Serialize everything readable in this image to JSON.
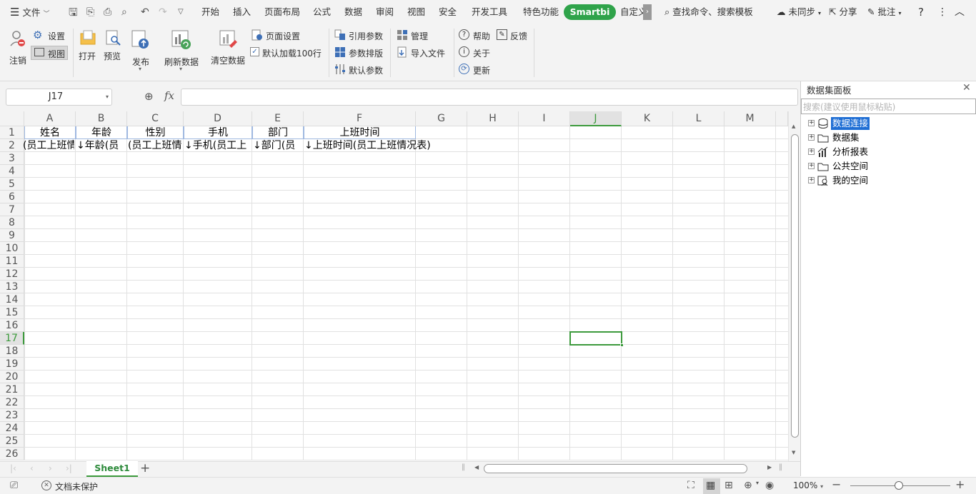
{
  "menu": {
    "file": "文件",
    "tabs": [
      "开始",
      "插入",
      "页面布局",
      "公式",
      "数据",
      "审阅",
      "视图",
      "安全",
      "开发工具",
      "特色功能"
    ],
    "smartbi": "Smartbi",
    "custom": "自定义",
    "search": "查找命令、搜索模板",
    "sync": "未同步",
    "share": "分享",
    "comment": "批注"
  },
  "ribbon": {
    "logout": "注销",
    "settings": "设置",
    "view": "视图",
    "open": "打开",
    "preview": "预览",
    "publish": "发布",
    "refresh": "刷新数据",
    "clear": "清空数据",
    "page_setup": "页面设置",
    "load100": "默认加载100行",
    "ref_param": "引用参数",
    "param_layout": "参数排版",
    "default_param": "默认参数",
    "manage": "管理",
    "import": "导入文件",
    "help": "帮助",
    "feedback": "反馈",
    "about": "关于",
    "update": "更新"
  },
  "formula_bar": {
    "cell_ref": "J17",
    "fx": "fx",
    "value": ""
  },
  "sheet": {
    "columns": [
      "A",
      "B",
      "C",
      "D",
      "E",
      "F",
      "G",
      "H",
      "I",
      "J",
      "K",
      "L",
      "M"
    ],
    "rows": [
      "1",
      "2",
      "3",
      "4",
      "5",
      "6",
      "7",
      "8",
      "9",
      "10",
      "11",
      "12",
      "13",
      "14",
      "15",
      "16",
      "17",
      "18",
      "19",
      "20",
      "21",
      "22",
      "23",
      "24",
      "25",
      "26"
    ],
    "selected_col": "J",
    "selected_row": "17",
    "row1": [
      "姓名",
      "年龄",
      "性别",
      "手机",
      "部门",
      "上班时间"
    ],
    "row2": [
      "(员工上班情",
      "↓年龄(员",
      "(员工上班情",
      "↓手机(员工上",
      "↓部门(员",
      "↓上班时间(员工上班情况表)"
    ]
  },
  "panel": {
    "title": "数据集面板",
    "search_placeholder": "搜索(建议使用鼠标粘贴)",
    "tree": [
      "数据连接",
      "数据集",
      "分析报表",
      "公共空间",
      "我的空间"
    ]
  },
  "tabs": {
    "sheet1": "Sheet1",
    "add": "+"
  },
  "status": {
    "protect": "文档未保护",
    "zoom": "100%"
  },
  "colors": {
    "accent_green": "#3c9a3c",
    "smartbi_bg": "#2fa34a",
    "selection_bg": "#1f6ed4"
  }
}
